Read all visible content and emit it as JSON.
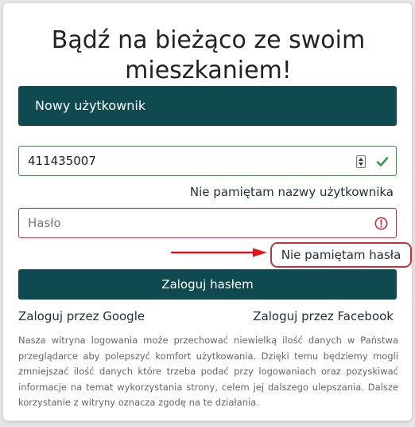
{
  "header": {
    "title_line1": "Bądź na bieżąco ze swoim",
    "title_line2": "mieszkaniem!"
  },
  "new_user": {
    "label": "Nowy użytkownik"
  },
  "username_field": {
    "value": "411435007",
    "state": "valid",
    "status_icon": "check-icon"
  },
  "forgot_username": {
    "label": "Nie pamiętam nazwy użytkownika"
  },
  "password_field": {
    "placeholder": "Hasło",
    "value": "",
    "state": "invalid",
    "status_icon": "exclamation-circle-icon"
  },
  "forgot_password": {
    "label": "Nie pamiętam hasła",
    "highlighted": true
  },
  "annotation": {
    "arrow_icon": "red-arrow-right-icon"
  },
  "login_button": {
    "label": "Zaloguj hasłem"
  },
  "social": {
    "google_label": "Zaloguj przez Google",
    "facebook_label": "Zaloguj przez Facebook"
  },
  "cookie_notice": {
    "text": "Nasza witryna logowania może przechować niewielką ilość danych w Państwa przeglądarce aby polepszyć komfort użytkowania. Dzięki temu będziemy mogli zmniejszać ilość danych które trzeba podać przy logowaniach oraz pozyskiwać informacje na temat wykorzystania strony, celem jej dalszego ulepszania. Dalsze korzystanie z witryny oznacza zgodę na te działania."
  },
  "colors": {
    "primary": "#0e4a4f",
    "valid": "#2e9e3e",
    "invalid": "#c7303c",
    "highlight": "#e0141a"
  }
}
